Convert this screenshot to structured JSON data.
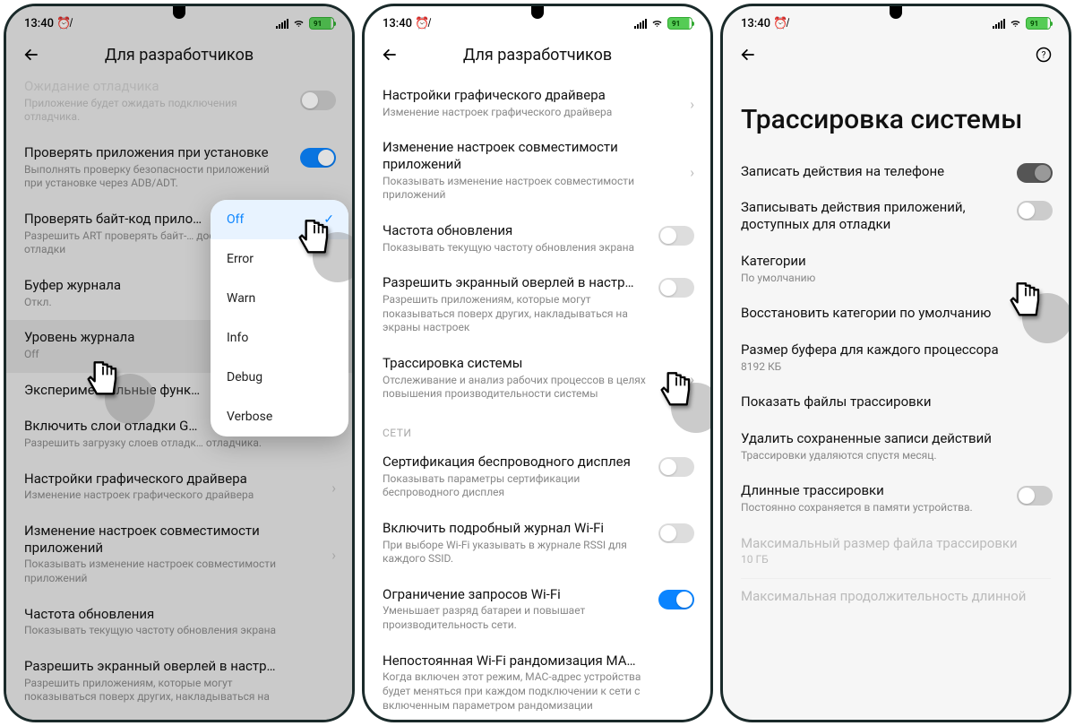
{
  "status": {
    "time": "13:40",
    "battery": "91"
  },
  "headers": {
    "devopt": "Для разработчиков"
  },
  "p1": {
    "items": [
      {
        "t": "Ожидание отладчика",
        "s": "Приложение будет ожидать подключения отладчика."
      },
      {
        "t": "Проверять приложения при установке",
        "s": "Выполнять проверку безопасности приложений при установке через ADB/ADT."
      },
      {
        "t": "Проверять байт-код прило…",
        "s": "Разрешить ART проверять байт-… доступных для отладки"
      },
      {
        "t": "Буфер журнала",
        "s": "Откл."
      },
      {
        "t": "Уровень журнала",
        "s": "Off"
      },
      {
        "t": "Экспериментальные функ…",
        "s": ""
      },
      {
        "t": "Включить слои отладки G…",
        "s": "Разрешить загрузку слоев отладк… отладчика."
      },
      {
        "t": "Настройки графического драйвера",
        "s": "Изменение настроек графического драйвера"
      },
      {
        "t": "Изменение настроек совместимости приложений",
        "s": "Показывать изменение настроек совместимости приложений"
      },
      {
        "t": "Частота обновления",
        "s": "Показывать текущую частоту обновления экрана"
      },
      {
        "t": "Разрешить экранный оверлей в настр…",
        "s": "Разрешить приложениям, которые могут показываться поверх других, накладываться на"
      }
    ],
    "popup": [
      "Off",
      "Error",
      "Warn",
      "Info",
      "Debug",
      "Verbose"
    ]
  },
  "p2": {
    "items": [
      {
        "t": "Настройки графического драйвера",
        "s": "Изменение настроек графического драйвера"
      },
      {
        "t": "Изменение настроек совместимости приложений",
        "s": "Показывать изменение настроек совместимости приложений"
      },
      {
        "t": "Частота обновления",
        "s": "Показывать текущую частоту обновления экрана"
      },
      {
        "t": "Разрешить экранный оверлей в настр…",
        "s": "Разрешить приложениям, которые могут показываться поверх других, накладываться на экраны настроек"
      },
      {
        "t": "Трассировка системы",
        "s": "Отслеживание и анализ рабочих процессов в целях повышения производительности системы"
      }
    ],
    "section": "СЕТИ",
    "net": [
      {
        "t": "Сертификация беспроводного дисплея",
        "s": "Показывать параметры сертификации беспроводного дисплея"
      },
      {
        "t": "Включить подробный журнал Wi-Fi",
        "s": "При выборе Wi-Fi указывать в журнале RSSI для каждого SSID."
      },
      {
        "t": "Ограничение запросов Wi-Fi",
        "s": "Уменьшает разряд батареи и повышает производительность сети."
      },
      {
        "t": "Непостоянная Wi-Fi рандомизация MA…",
        "s": "Когда включен этот режим, MAC-адрес устройства будет меняться при каждом подключении к сети с включенным параметром рандомизации"
      }
    ]
  },
  "p3": {
    "title": "Трассировка системы",
    "items": [
      {
        "t": "Записать действия на телефоне",
        "s": ""
      },
      {
        "t": "Записывать действия приложений, доступных для отладки",
        "s": ""
      },
      {
        "t": "Категории",
        "s": "По умолчанию"
      },
      {
        "t": "Восстановить категории по умолчанию",
        "s": ""
      },
      {
        "t": "Размер буфера для каждого процессора",
        "s": "8192 КБ"
      },
      {
        "t": "Показать файлы трассировки",
        "s": ""
      },
      {
        "t": "Удалить сохраненные записи действий",
        "s": "Трассировки удаляются спустя месяц."
      },
      {
        "t": "Длинные трассировки",
        "s": "Постоянно сохраняется в памяти устройства."
      },
      {
        "t": "Максимальный размер файла трассировки",
        "s": "10 ГБ"
      },
      {
        "t": "Максимальная продолжительность длинной",
        "s": ""
      }
    ]
  }
}
